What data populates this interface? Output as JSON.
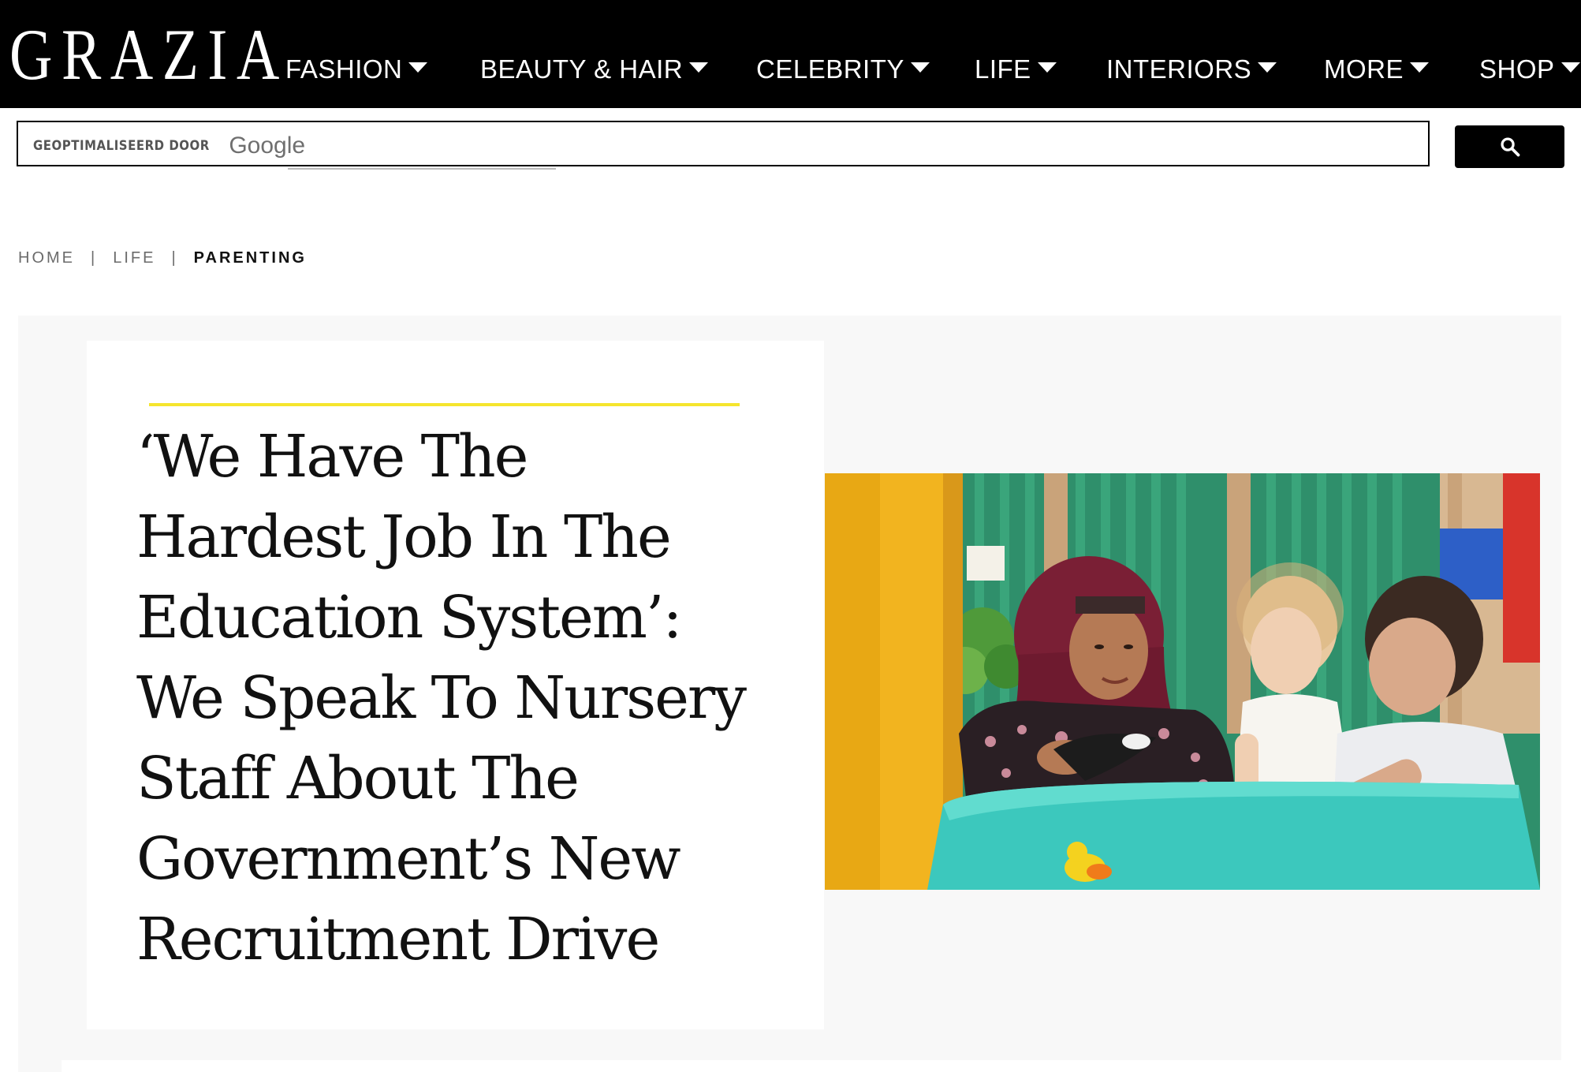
{
  "header": {
    "logo_text": "GRAZIA",
    "nav": [
      {
        "label": "FASHION"
      },
      {
        "label": "BEAUTY & HAIR"
      },
      {
        "label": "CELEBRITY"
      },
      {
        "label": "LIFE"
      },
      {
        "label": "INTERIORS"
      },
      {
        "label": "MORE"
      },
      {
        "label": "SHOP"
      }
    ]
  },
  "search": {
    "powered_by_label": "GEOPTIMALISEERD DOOR",
    "google_label": "Google",
    "button_icon": "search-icon"
  },
  "breadcrumb": {
    "items": [
      {
        "label": "HOME"
      },
      {
        "label": "LIFE"
      },
      {
        "label": "PARENTING"
      }
    ],
    "separator": "|"
  },
  "article": {
    "headline_lines": [
      "‘We Have The",
      "Hardest Job In The",
      "Education System’:",
      "We Speak To Nursery",
      "Staff About The",
      "Government’s New",
      "Recruitment Drive"
    ],
    "accent_color": "#f5e52d"
  }
}
